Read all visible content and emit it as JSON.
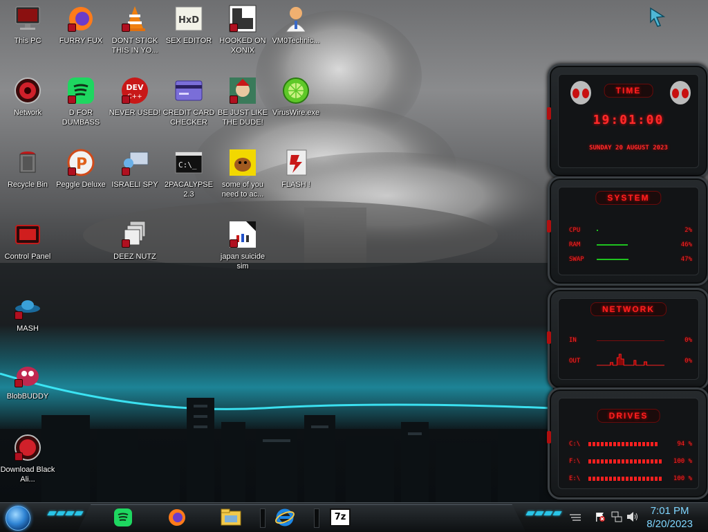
{
  "desktop_icons": [
    {
      "label": "This PC"
    },
    {
      "label": "FURRY FUX"
    },
    {
      "label": "DONT STICK THIS IN YO..."
    },
    {
      "label": "SEX EDITOR"
    },
    {
      "label": "HOOKED ON XONIX"
    },
    {
      "label": "VM0Technic..."
    },
    {
      "label": "Network"
    },
    {
      "label": "D FOR DUMBASS"
    },
    {
      "label": "NEVER USED!"
    },
    {
      "label": "CREDIT CARD CHECKER"
    },
    {
      "label": "BE JUST LIKE THE DUDE!"
    },
    {
      "label": "VirusWire.exe"
    },
    {
      "label": "Recycle Bin"
    },
    {
      "label": "Peggle Deluxe"
    },
    {
      "label": "ISRAELI SPY"
    },
    {
      "label": "2PACALYPSE 2.3"
    },
    {
      "label": "some of you need to ac..."
    },
    {
      "label": "FLASH !"
    },
    {
      "label": "Control Panel"
    },
    {
      "label": "DEEZ NUTZ"
    },
    {
      "label": "japan suicide sim"
    },
    {
      "label": "MASH"
    },
    {
      "label": "BlobBUDDY"
    },
    {
      "label": "Download Black Ali..."
    }
  ],
  "icon_glyphs": {
    "dev": "DEV",
    "dev_sub": "C++",
    "hxd": "HxD",
    "cmd": "C:\\_"
  },
  "gadget": {
    "time": {
      "title": "TIME",
      "clock": "19:01:00",
      "date": "SUNDAY 20 AUGUST 2023"
    },
    "system": {
      "title": "SYSTEM",
      "rows": [
        {
          "label": "CPU",
          "value": "2%",
          "level": 0.02
        },
        {
          "label": "RAM",
          "value": "46%",
          "level": 0.46
        },
        {
          "label": "SWAP",
          "value": "47%",
          "level": 0.47
        }
      ]
    },
    "network": {
      "title": "NETWORK",
      "rows": [
        {
          "label": "IN",
          "value": "0%"
        },
        {
          "label": "OUT",
          "value": "0%"
        }
      ]
    },
    "drives": {
      "title": "DRIVES",
      "rows": [
        {
          "label": "C:\\",
          "value": "94 %",
          "level": 0.94
        },
        {
          "label": "F:\\",
          "value": "100 %",
          "level": 1.0
        },
        {
          "label": "E:\\",
          "value": "100 %",
          "level": 1.0
        }
      ]
    }
  },
  "taskbar": {
    "apps": [
      {
        "name": "Spotify"
      },
      {
        "name": "Firefox"
      },
      {
        "name": "File Explorer"
      },
      {
        "name": "Internet Explorer"
      },
      {
        "name": "7-Zip",
        "glyph": "7z"
      }
    ],
    "clock": {
      "time": "7:01 PM",
      "date": "8/20/2023"
    }
  },
  "colors": {
    "accent_red": "#ff2020",
    "accent_cyan": "#29c5e8",
    "clock_blue": "#7fd6ff"
  }
}
